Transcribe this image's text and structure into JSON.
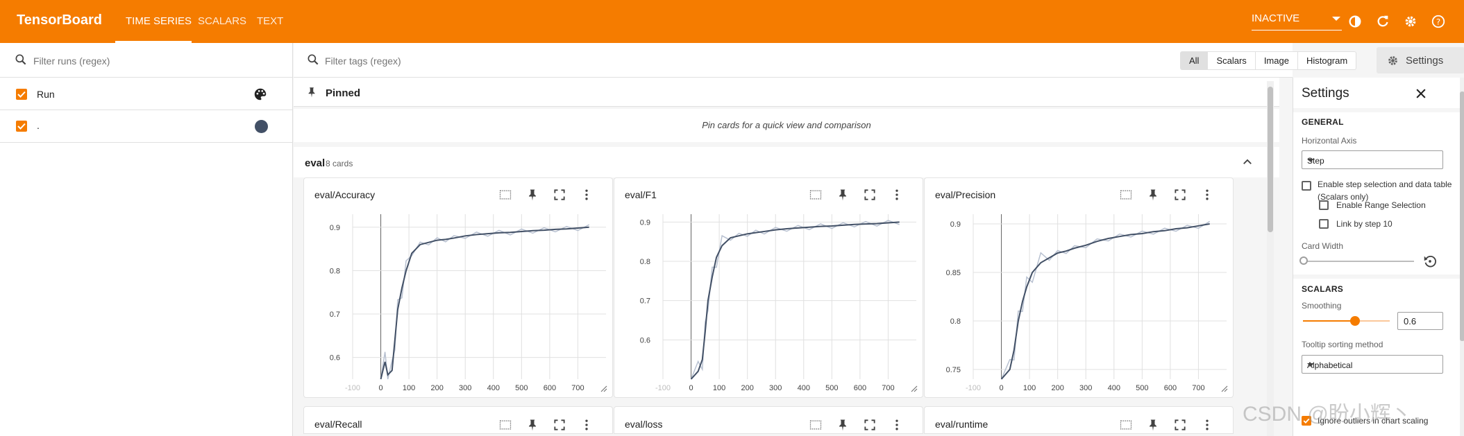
{
  "app": {
    "brand": "TensorBoard",
    "nav_tabs": [
      "TIME SERIES",
      "SCALARS",
      "TEXT"
    ],
    "reload_status": "INACTIVE",
    "accent_color": "#f57c00"
  },
  "runs_sidebar": {
    "filter_placeholder": "Filter runs (regex)",
    "runs": [
      {
        "label": "Run",
        "checked": true,
        "icon": "palette-icon"
      },
      {
        "label": ".",
        "checked": true,
        "color": "#425066"
      }
    ]
  },
  "main": {
    "filter_placeholder": "Filter tags (regex)",
    "type_filters": [
      "All",
      "Scalars",
      "Image",
      "Histogram"
    ],
    "active_filter": "All",
    "settings_button": "Settings",
    "pinned": {
      "title": "Pinned",
      "empty_hint": "Pin cards for a quick view and comparison"
    },
    "group": {
      "name": "eval",
      "count": "8 cards"
    },
    "cards": [
      {
        "title": "eval/Accuracy"
      },
      {
        "title": "eval/F1"
      },
      {
        "title": "eval/Precision"
      },
      {
        "title": "eval/Recall"
      },
      {
        "title": "eval/loss"
      },
      {
        "title": "eval/runtime"
      }
    ]
  },
  "settings_panel": {
    "title": "Settings",
    "general_heading": "GENERAL",
    "horizontal_axis_label": "Horizontal Axis",
    "horizontal_axis_value": "Step",
    "step_selection_label": "Enable step selection and data table (Scalars only)",
    "range_selection_label": "Enable Range Selection",
    "link_by_step_label": "Link by step 10",
    "card_width_label": "Card Width",
    "scalars_heading": "SCALARS",
    "smoothing_label": "Smoothing",
    "smoothing_value": "0.6",
    "smoothing_fraction": 0.6,
    "tooltip_sort_label": "Tooltip sorting method",
    "tooltip_sort_value": "Alphabetical",
    "ignore_outliers_label": "Ignore outliers in chart scaling"
  },
  "watermark": "CSDN @盼小辉丶",
  "chart_data": [
    {
      "type": "line",
      "title": "eval/Accuracy",
      "x_ticks": [
        "-100",
        "0",
        "100",
        "200",
        "300",
        "400",
        "500",
        "600",
        "700"
      ],
      "y_ticks": [
        "0.6",
        "0.7",
        "0.8",
        "0.9"
      ],
      "xlim": [
        -100,
        800
      ],
      "ylim": [
        0.55,
        0.93
      ],
      "smoothing": 0.6,
      "series": [
        {
          "name": "Run",
          "color": "#425066",
          "x": [
            0,
            15,
            25,
            40,
            50,
            60,
            75,
            90,
            110,
            140,
            170,
            200,
            230,
            260,
            300,
            340,
            380,
            420,
            460,
            500,
            540,
            580,
            620,
            660,
            700,
            740
          ],
          "y": [
            0.55,
            0.59,
            0.56,
            0.57,
            0.64,
            0.71,
            0.76,
            0.8,
            0.84,
            0.86,
            0.865,
            0.87,
            0.872,
            0.875,
            0.88,
            0.883,
            0.885,
            0.887,
            0.888,
            0.89,
            0.892,
            0.893,
            0.895,
            0.896,
            0.898,
            0.9
          ]
        }
      ]
    },
    {
      "type": "line",
      "title": "eval/F1",
      "x_ticks": [
        "-100",
        "0",
        "100",
        "200",
        "300",
        "400",
        "500",
        "600",
        "700"
      ],
      "y_ticks": [
        "0.6",
        "0.7",
        "0.8",
        "0.9"
      ],
      "xlim": [
        -100,
        800
      ],
      "ylim": [
        0.5,
        0.92
      ],
      "smoothing": 0.6,
      "series": [
        {
          "name": "Run",
          "color": "#425066",
          "x": [
            0,
            25,
            40,
            50,
            60,
            75,
            90,
            110,
            140,
            170,
            200,
            230,
            260,
            300,
            340,
            380,
            420,
            460,
            500,
            540,
            580,
            620,
            660,
            700,
            740
          ],
          "y": [
            0.5,
            0.52,
            0.55,
            0.62,
            0.7,
            0.76,
            0.81,
            0.84,
            0.86,
            0.865,
            0.87,
            0.873,
            0.876,
            0.88,
            0.883,
            0.885,
            0.887,
            0.889,
            0.89,
            0.892,
            0.894,
            0.895,
            0.896,
            0.898,
            0.9
          ]
        }
      ]
    },
    {
      "type": "line",
      "title": "eval/Precision",
      "x_ticks": [
        "-100",
        "0",
        "100",
        "200",
        "300",
        "400",
        "500",
        "600",
        "700"
      ],
      "y_ticks": [
        "0.75",
        "0.8",
        "0.85",
        "0.9"
      ],
      "xlim": [
        -100,
        800
      ],
      "ylim": [
        0.74,
        0.91
      ],
      "smoothing": 0.6,
      "series": [
        {
          "name": "Run",
          "color": "#425066",
          "x": [
            0,
            30,
            45,
            60,
            75,
            90,
            110,
            140,
            170,
            200,
            230,
            260,
            300,
            340,
            380,
            420,
            460,
            500,
            540,
            580,
            620,
            660,
            700,
            740
          ],
          "y": [
            0.74,
            0.75,
            0.77,
            0.8,
            0.82,
            0.835,
            0.85,
            0.86,
            0.865,
            0.87,
            0.872,
            0.875,
            0.878,
            0.882,
            0.885,
            0.887,
            0.889,
            0.89,
            0.892,
            0.893,
            0.895,
            0.896,
            0.898,
            0.9
          ]
        }
      ]
    }
  ]
}
